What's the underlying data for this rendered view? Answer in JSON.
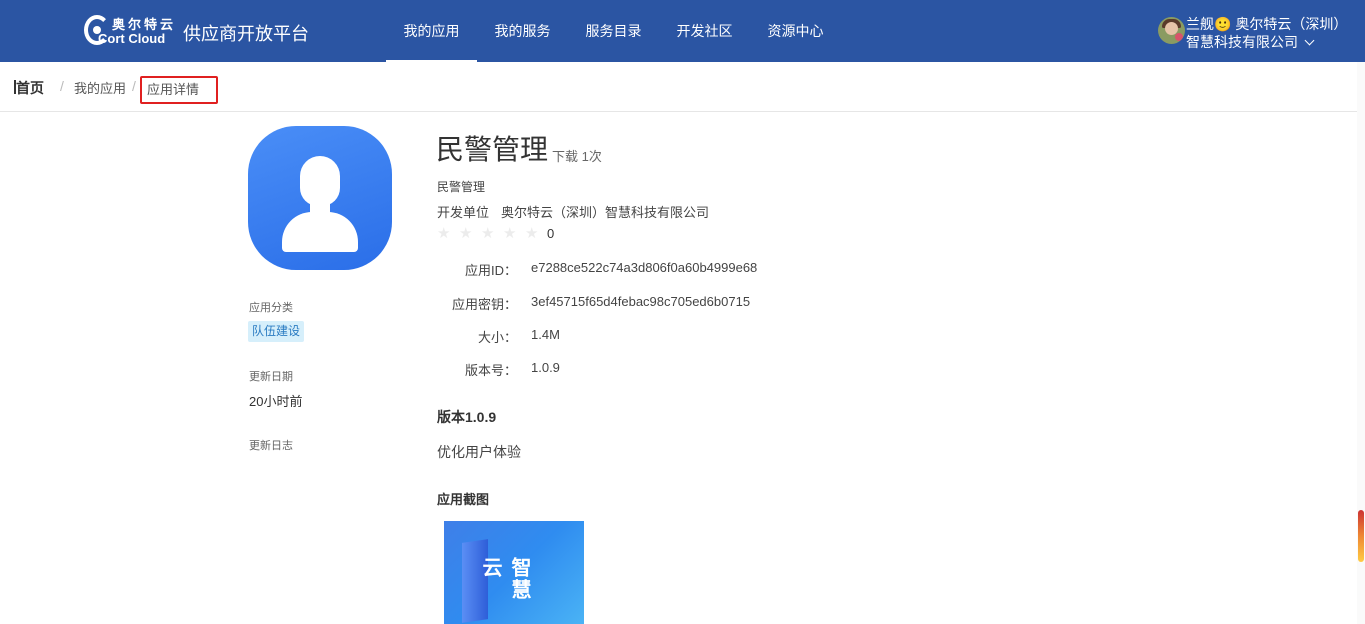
{
  "header": {
    "logo_cn": "奥尔特云",
    "logo_en": "Cort Cloud",
    "platform_title": "供应商开放平台",
    "nav": [
      {
        "label": "我的应用",
        "active": true
      },
      {
        "label": "我的服务",
        "active": false
      },
      {
        "label": "服务目录",
        "active": false
      },
      {
        "label": "开发社区",
        "active": false
      },
      {
        "label": "资源中心",
        "active": false
      }
    ],
    "user_line1": "兰舰🙂 奥尔特云（深圳）",
    "user_line2": "智慧科技有限公司",
    "bg_color": "#2b55a3"
  },
  "breadcrumb": {
    "home": "首页",
    "sep": "/",
    "parent": "我的应用",
    "current": "应用详情"
  },
  "sidebar": {
    "category_label": "应用分类",
    "category_tag": "队伍建设",
    "updated_label": "更新日期",
    "updated_value": "20小时前",
    "changelog_label": "更新日志"
  },
  "app": {
    "name": "民警管理",
    "downloads": "下载 1次",
    "subtitle": "民警管理",
    "developer_label": "开发单位",
    "developer_value": "奥尔特云（深圳）智慧科技有限公司",
    "rating": "0",
    "star_count": 5,
    "fields": [
      {
        "label": "应用ID：",
        "value": "e7288ce522c74a3d806f0a60b4999e68"
      },
      {
        "label": "应用密钥：",
        "value": "3ef45715f65d4febac98c705ed6b0715"
      },
      {
        "label": "大小：",
        "value": "1.4M"
      },
      {
        "label": "版本号：",
        "value": "1.0.9"
      }
    ],
    "version_title": "版本1.0.9",
    "version_desc": "优化用户体验",
    "screenshots_title": "应用截图",
    "screenshot_caption": "智慧云"
  }
}
